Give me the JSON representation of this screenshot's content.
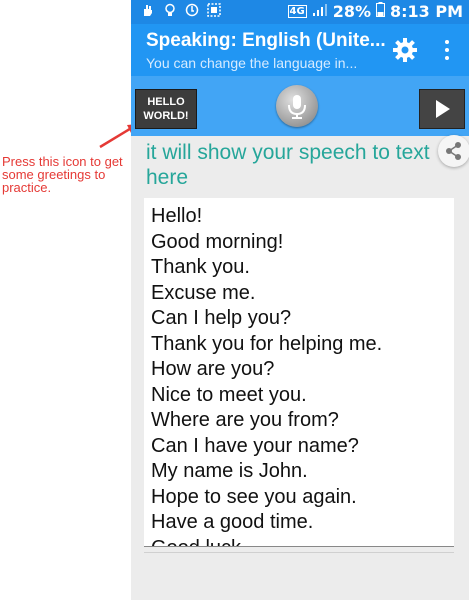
{
  "status_bar": {
    "network": "4G",
    "battery": "28%",
    "time": "8:13 PM"
  },
  "app_bar": {
    "title": "Speaking: English (Unite...",
    "subtitle": "You can change the language in..."
  },
  "toolbar": {
    "hello_label_line1": "HELLO",
    "hello_label_line2": "WORLD!"
  },
  "speech_placeholder": "it will show your speech to text here",
  "greetings": [
    "Hello!",
    "Good morning!",
    "Thank you.",
    "Excuse me.",
    "Can I help you?",
    "Thank you for helping me.",
    "How are you?",
    "Nice to meet you.",
    "Where are you from?",
    "Can I have your name?",
    "My name is John.",
    "Hope to see you again.",
    "Have a good time.",
    "Good luck."
  ],
  "annotation": {
    "text": "Press this icon to get some greetings to practice."
  },
  "colors": {
    "status_bar": "#1e88e5",
    "app_bar": "#2196f3",
    "toolbar": "#42a5f5",
    "speech_text": "#26a69a",
    "annotation": "#e53935"
  }
}
